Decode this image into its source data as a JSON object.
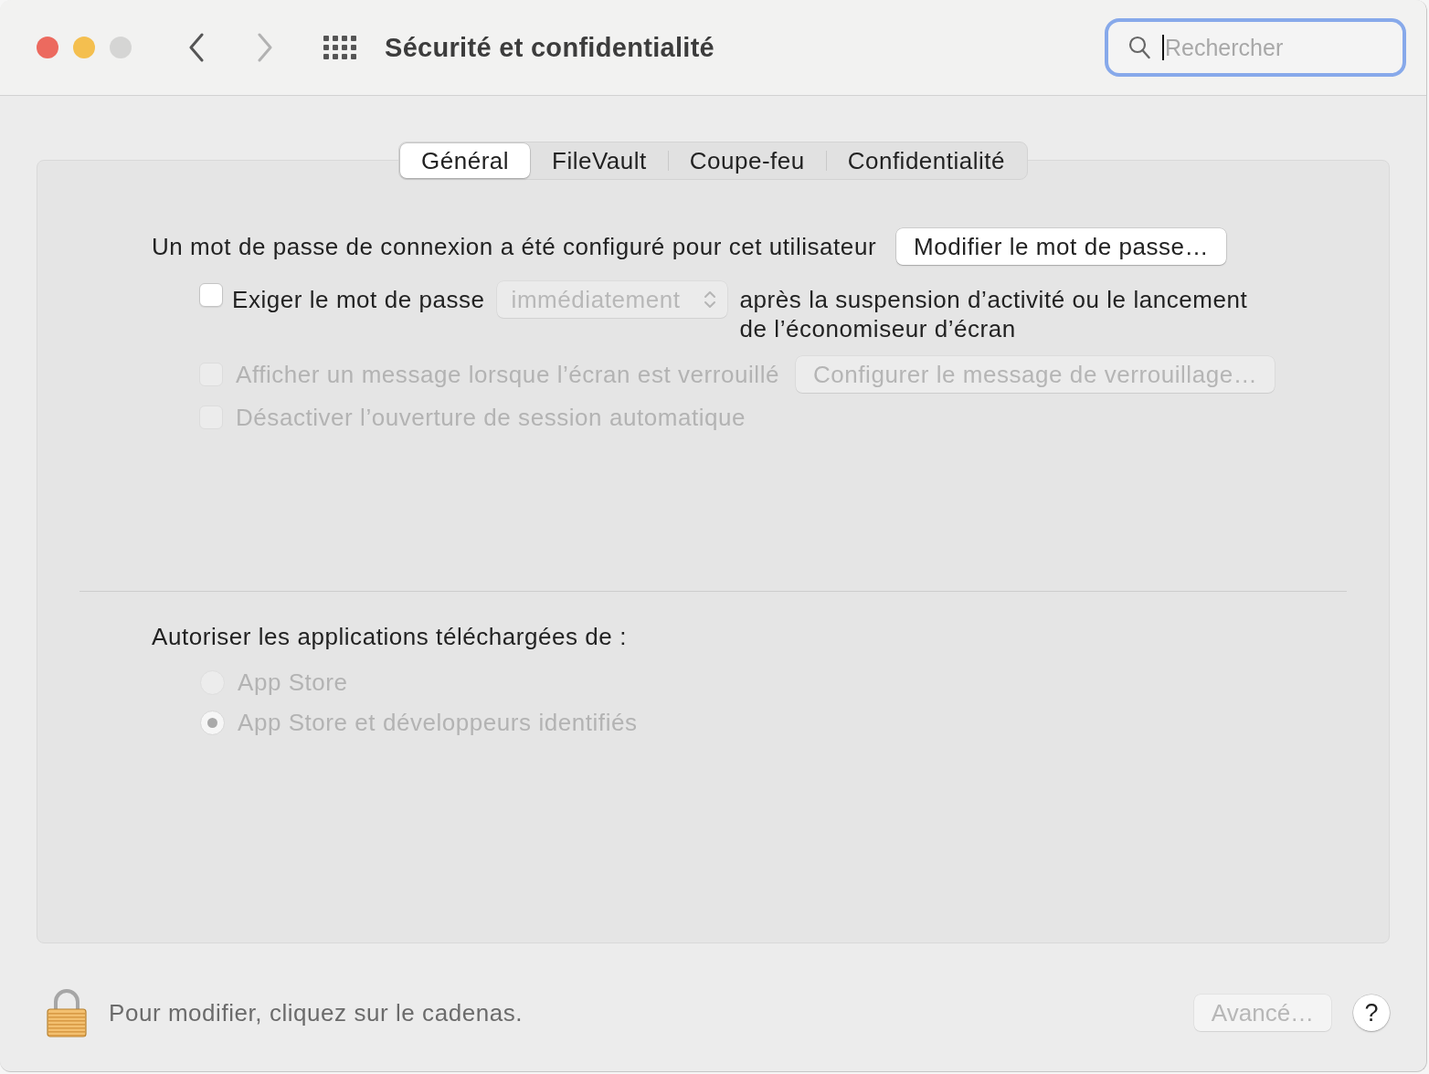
{
  "window": {
    "title": "Sécurité et confidentialité",
    "controls": [
      {
        "color": "#ec6a5f"
      },
      {
        "color": "#f4bf4f"
      },
      {
        "color": "#d5d5d4"
      }
    ]
  },
  "toolbar": {
    "nav": [
      {
        "kind": "back",
        "disabled": false
      },
      {
        "kind": "forward",
        "disabled": true
      }
    ]
  },
  "search": {
    "placeholder": "Rechercher",
    "focused": true
  },
  "tabs": [
    {
      "label": "Général",
      "selected": true
    },
    {
      "label": "FileVault",
      "selected": false
    },
    {
      "label": "Coupe-feu",
      "selected": false
    },
    {
      "label": "Confidentialité",
      "selected": false
    }
  ],
  "login_password": {
    "text": "Un mot de passe de connexion a été configuré pour cet utilisateur",
    "button": {
      "label": "Modifier le mot de passe…",
      "disabled": false
    }
  },
  "require_password": {
    "label": "Exiger le mot de passe",
    "checked": false,
    "disabled": false,
    "delay": {
      "value": "immédiatement",
      "disabled": true
    },
    "suffix": "après la suspension d’activité ou le lancement de l’économiseur d’écran"
  },
  "lock_message": {
    "label": "Afficher un message lorsque l’écran est verrouillé",
    "checked": false,
    "disabled": true,
    "button": {
      "label": "Configurer le message de verrouillage…",
      "disabled": true
    }
  },
  "auto_login": {
    "label": "Désactiver l’ouverture de session automatique",
    "checked": false,
    "disabled": true
  },
  "downloads": {
    "label": "Autoriser les applications téléchargées de :",
    "options": [
      {
        "label": "App Store",
        "selected": false,
        "disabled": true
      },
      {
        "label": "App Store et développeurs identifiés",
        "selected": true,
        "disabled": true
      }
    ]
  },
  "footer": {
    "locked": true,
    "message": "Pour modifier, cliquez sur le cadenas.",
    "advanced_button": {
      "label": "Avancé…",
      "disabled": true
    },
    "help_button": {
      "label": "?"
    }
  }
}
